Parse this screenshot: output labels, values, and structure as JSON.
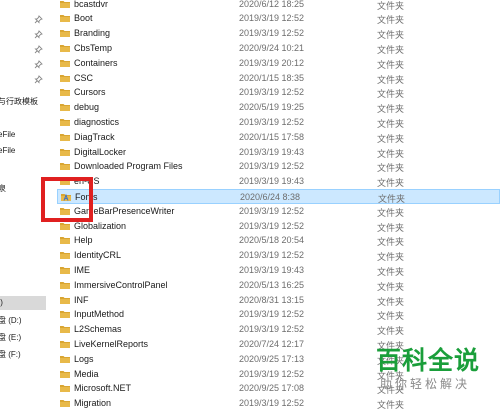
{
  "nav_pane": {
    "items": [
      {
        "label": "",
        "pinned": true
      },
      {
        "label": "",
        "pinned": true
      },
      {
        "label": "",
        "pinned": true
      },
      {
        "label": "",
        "pinned": true
      },
      {
        "label": "",
        "pinned": true
      },
      {
        "label": "与行政模板",
        "pinned": false
      },
      {
        "label": "eFile",
        "pinned": false
      },
      {
        "label": "eFile",
        "pinned": false
      },
      {
        "label": "泉",
        "pinned": false
      },
      {
        "label": ":)",
        "pinned": false,
        "selected": true
      },
      {
        "label": "盘 (D:)",
        "pinned": false
      },
      {
        "label": "盘 (E:)",
        "pinned": false
      },
      {
        "label": "盘 (F:)",
        "pinned": false
      }
    ]
  },
  "file_list": {
    "rows": [
      {
        "name": "bcastdvr",
        "date": "2020/6/12 18:25",
        "type": "文件夹"
      },
      {
        "name": "Boot",
        "date": "2019/3/19 12:52",
        "type": "文件夹"
      },
      {
        "name": "Branding",
        "date": "2019/3/19 12:52",
        "type": "文件夹"
      },
      {
        "name": "CbsTemp",
        "date": "2020/9/24 10:21",
        "type": "文件夹"
      },
      {
        "name": "Containers",
        "date": "2019/3/19 20:12",
        "type": "文件夹"
      },
      {
        "name": "CSC",
        "date": "2020/1/15 18:35",
        "type": "文件夹"
      },
      {
        "name": "Cursors",
        "date": "2019/3/19 12:52",
        "type": "文件夹"
      },
      {
        "name": "debug",
        "date": "2020/5/19 19:25",
        "type": "文件夹"
      },
      {
        "name": "diagnostics",
        "date": "2019/3/19 12:52",
        "type": "文件夹"
      },
      {
        "name": "DiagTrack",
        "date": "2020/1/15 17:58",
        "type": "文件夹"
      },
      {
        "name": "DigitalLocker",
        "date": "2019/3/19 19:43",
        "type": "文件夹"
      },
      {
        "name": "Downloaded Program Files",
        "date": "2019/3/19 12:52",
        "type": "文件夹"
      },
      {
        "name": "en-US",
        "date": "2019/3/19 19:43",
        "type": "文件夹"
      },
      {
        "name": "Fonts",
        "date": "2020/6/24 8:38",
        "type": "文件夹",
        "selected": true,
        "special": true
      },
      {
        "name": "GameBarPresenceWriter",
        "date": "2019/3/19 12:52",
        "type": "文件夹"
      },
      {
        "name": "Globalization",
        "date": "2019/3/19 12:52",
        "type": "文件夹"
      },
      {
        "name": "Help",
        "date": "2020/5/18 20:54",
        "type": "文件夹"
      },
      {
        "name": "IdentityCRL",
        "date": "2019/3/19 12:52",
        "type": "文件夹"
      },
      {
        "name": "IME",
        "date": "2019/3/19 19:43",
        "type": "文件夹"
      },
      {
        "name": "ImmersiveControlPanel",
        "date": "2020/5/13 16:25",
        "type": "文件夹"
      },
      {
        "name": "INF",
        "date": "2020/8/31 13:15",
        "type": "文件夹"
      },
      {
        "name": "InputMethod",
        "date": "2019/3/19 12:52",
        "type": "文件夹"
      },
      {
        "name": "L2Schemas",
        "date": "2019/3/19 12:52",
        "type": "文件夹"
      },
      {
        "name": "LiveKernelReports",
        "date": "2020/7/24 12:17",
        "type": "文件夹"
      },
      {
        "name": "Logs",
        "date": "2020/9/25 17:13",
        "type": "文件夹"
      },
      {
        "name": "Media",
        "date": "2019/3/19 12:52",
        "type": "文件夹"
      },
      {
        "name": "Microsoft.NET",
        "date": "2020/9/25 17:08",
        "type": "文件夹"
      },
      {
        "name": "Migration",
        "date": "2019/3/19 12:52",
        "type": "文件夹"
      }
    ]
  },
  "watermark": {
    "logo": "百科全说",
    "tagline": "助你轻松解决"
  },
  "colors": {
    "folder": "#e8b949",
    "folder_tab": "#d9a531",
    "selection_bg": "#cce8ff",
    "selection_border": "#99d1ff",
    "highlight": "#e02020",
    "watermark_green": "#1a9e3a"
  }
}
